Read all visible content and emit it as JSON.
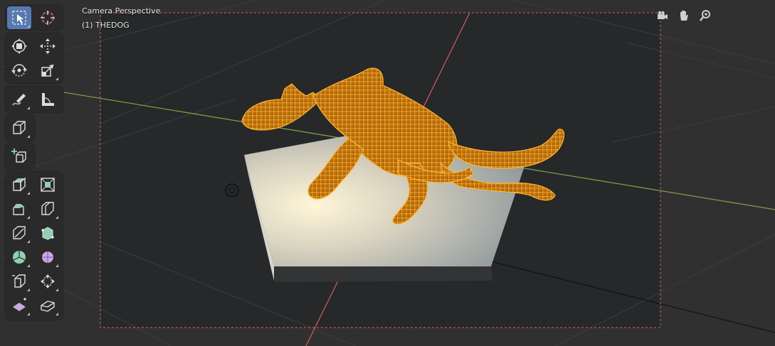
{
  "viewport": {
    "mode_label": "Camera Perspective",
    "object_label": "(1) THEDOG"
  },
  "colors": {
    "background": "#2f2f2f",
    "camera_frame": "#e06060",
    "selection": "#f59c1a",
    "active_tool": "#5779b0",
    "x_axis": "#c55757",
    "y_axis": "#86a24a"
  },
  "toolbar": {
    "tools": [
      {
        "name": "select-box-tool",
        "icon": "select-box-icon",
        "active": true
      },
      {
        "name": "cursor-tool",
        "icon": "cursor-icon",
        "active": false
      },
      {
        "name": "transform-tool",
        "icon": "transform-icon",
        "active": false
      },
      {
        "name": "move-tool",
        "icon": "move-icon",
        "active": false
      },
      {
        "name": "rotate-tool",
        "icon": "rotate-icon",
        "active": false
      },
      {
        "name": "scale-tool",
        "icon": "scale-icon",
        "active": false
      },
      {
        "name": "annotate-tool",
        "icon": "annotate-icon",
        "active": false
      },
      {
        "name": "measure-tool",
        "icon": "measure-icon",
        "active": false
      },
      {
        "name": "add-cube-tool",
        "icon": "add-cube-icon",
        "active": false
      },
      {
        "name": "add-tool",
        "icon": "add-plus-cube-icon",
        "active": false
      },
      {
        "name": "extrude-region-tool",
        "icon": "extrude-icon",
        "active": false
      },
      {
        "name": "inset-faces-tool",
        "icon": "inset-icon",
        "active": false
      },
      {
        "name": "bevel-tool",
        "icon": "bevel-icon",
        "active": false
      },
      {
        "name": "loop-cut-tool",
        "icon": "loop-cut-icon",
        "active": false
      },
      {
        "name": "knife-tool",
        "icon": "knife-icon",
        "active": false
      },
      {
        "name": "poly-build-tool",
        "icon": "poly-build-icon",
        "active": false
      },
      {
        "name": "spin-tool",
        "icon": "spin-icon",
        "active": false
      },
      {
        "name": "smooth-tool",
        "icon": "smooth-icon",
        "active": false
      },
      {
        "name": "edge-slide-tool",
        "icon": "edge-slide-icon",
        "active": false
      },
      {
        "name": "shrink-fatten-tool",
        "icon": "shrink-fatten-icon",
        "active": false
      },
      {
        "name": "shear-tool",
        "icon": "shear-icon",
        "active": false
      },
      {
        "name": "rip-region-tool",
        "icon": "rip-icon",
        "active": false
      }
    ]
  },
  "navigation": [
    {
      "name": "camera-view-button",
      "icon": "camera-icon"
    },
    {
      "name": "pan-view-button",
      "icon": "hand-icon"
    },
    {
      "name": "zoom-view-button",
      "icon": "zoom-icon"
    }
  ]
}
